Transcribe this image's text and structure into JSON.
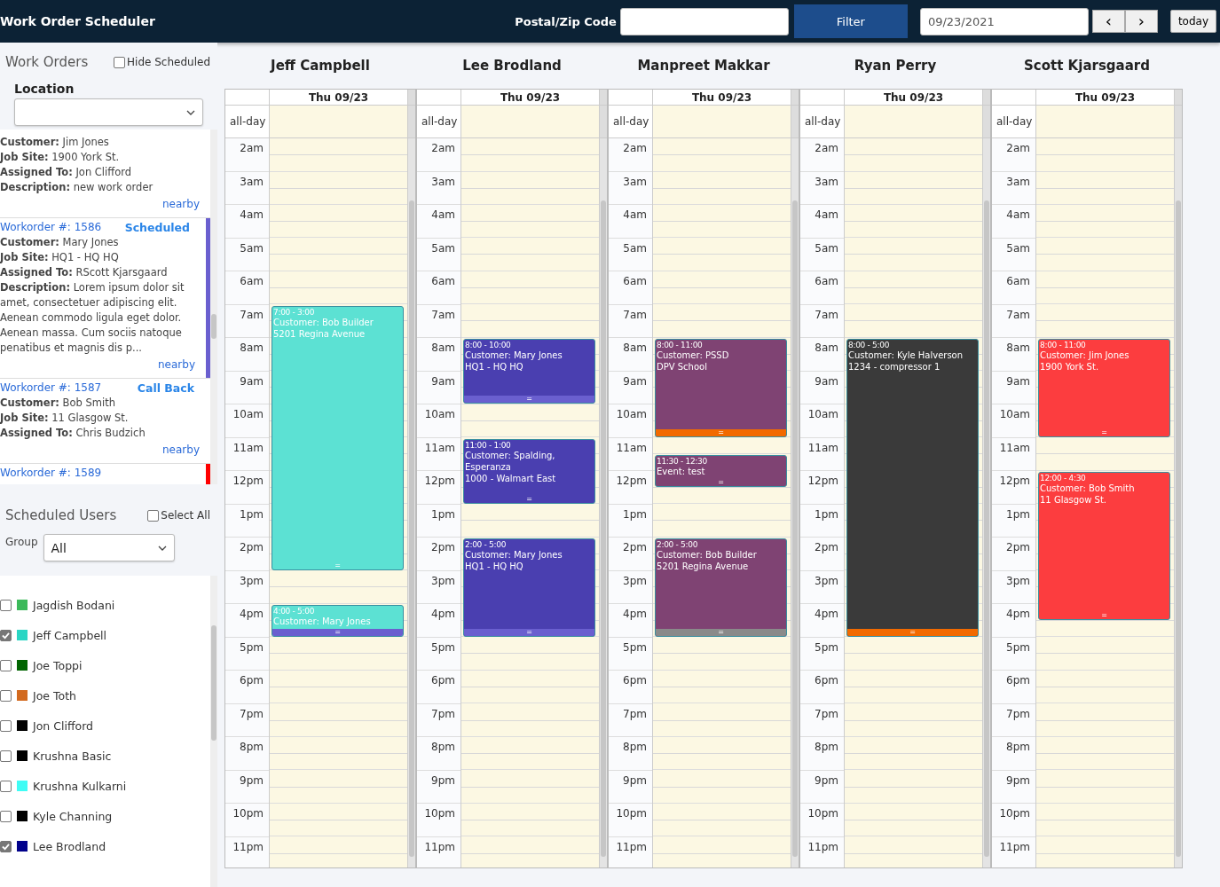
{
  "header": {
    "title": "Work Order Scheduler",
    "postal_label": "Postal/Zip Code",
    "filter_button": "Filter",
    "date_value": "09/23/2021",
    "prev_button": "‹",
    "next_button": "›",
    "today_button": "today"
  },
  "work_orders": {
    "heading": "Work Orders",
    "hide_scheduled": {
      "label": "Hide Scheduled",
      "checked": false
    },
    "location_label": "Location",
    "cards": [
      {
        "lines": [
          "**Customer:** Jim Jones",
          "**Job Site:** 1900 York St.",
          "**Assigned To:** Jon Clifford",
          "**Description:** new work order"
        ],
        "link": "nearby"
      },
      {
        "title": "Workorder #: 1586",
        "status": "Scheduled",
        "color": "#6a5fcf",
        "lines": [
          "**Customer:** Mary Jones",
          "**Job Site:** HQ1 - HQ HQ",
          "**Assigned To:** RScott Kjarsgaard",
          "**Description:** Lorem ipsum dolor sit amet, consectetuer adipiscing elit. Aenean commodo ligula eget dolor. Aenean massa. Cum sociis natoque penatibus et magnis dis p..."
        ],
        "link": "nearby"
      },
      {
        "title": "Workorder #: 1587",
        "status": "Call Back",
        "lines": [
          "**Customer:** Bob Smith",
          "**Job Site:** 11 Glasgow St.",
          "**Assigned To:** Chris Budzich"
        ],
        "link": "nearby"
      },
      {
        "title": "Workorder #: 1589",
        "color": "#ff0000"
      }
    ]
  },
  "scheduled_users": {
    "heading": "Scheduled Users",
    "select_all": {
      "label": "Select All",
      "checked": false
    },
    "group_label": "Group",
    "group_value": "All",
    "users": [
      {
        "name": "Jagdish Bodani",
        "color": "#3cb95a",
        "checked": false
      },
      {
        "name": "Jeff Campbell",
        "color": "#2ad6c4",
        "checked": true
      },
      {
        "name": "Joe Toppi",
        "color": "#006400",
        "checked": false
      },
      {
        "name": "Joe Toth",
        "color": "#d2691e",
        "checked": false
      },
      {
        "name": "Jon Clifford",
        "color": "#000000",
        "checked": false
      },
      {
        "name": "Krushna Basic",
        "color": "#000000",
        "checked": false
      },
      {
        "name": "Krushna Kulkarni",
        "color": "#3ffcf5",
        "checked": false
      },
      {
        "name": "Kyle Channing",
        "color": "#000000",
        "checked": false
      },
      {
        "name": "Lee Brodland",
        "color": "#00008b",
        "checked": true
      }
    ]
  },
  "columns": [
    {
      "name": "Jeff Campbell",
      "date": "Thu 09/23",
      "all_day": "all-day",
      "hours": [
        "2am",
        "3am",
        "4am",
        "5am",
        "6am",
        "7am",
        "8am",
        "9am",
        "10am",
        "11am",
        "12pm",
        "1pm",
        "2pm",
        "3pm",
        "4pm",
        "5pm",
        "6pm",
        "7pm",
        "8pm",
        "9pm",
        "10pm",
        "11pm"
      ],
      "events": [
        {
          "time": "7:00 - 3:00",
          "lines": [
            "Customer: Bob Builder",
            "5201 Regina Avenue"
          ],
          "handle": "=",
          "color": "#5ce1d3"
        },
        {
          "time": "4:00 - 5:00",
          "lines": [
            "Customer: Mary Jones"
          ],
          "handle": "=",
          "color": "#5ce1d3",
          "handle_bar": {
            "color": "#6a5fcf"
          }
        }
      ]
    },
    {
      "name": "Lee Brodland",
      "date": "Thu 09/23",
      "all_day": "all-day",
      "hours": [
        "2am",
        "3am",
        "4am",
        "5am",
        "6am",
        "7am",
        "8am",
        "9am",
        "10am",
        "11am",
        "12pm",
        "1pm",
        "2pm",
        "3pm",
        "4pm",
        "5pm",
        "6pm",
        "7pm",
        "8pm",
        "9pm",
        "10pm",
        "11pm"
      ],
      "events": [
        {
          "time": "8:00 - 10:00",
          "lines": [
            "Customer: Mary Jones",
            "HQ1 - HQ HQ"
          ],
          "handle": "=",
          "color": "#4a3fb0",
          "handle_bar": {
            "color": "#6a5fcf"
          }
        },
        {
          "time": "11:00 - 1:00",
          "lines": [
            "Customer: Spalding, Esperanza",
            "1000 - Walmart East"
          ],
          "handle": "=",
          "color": "#4a3fb0"
        },
        {
          "time": "2:00 - 5:00",
          "lines": [
            "Customer: Mary Jones",
            "HQ1 - HQ HQ"
          ],
          "handle": "=",
          "color": "#4a3fb0",
          "handle_bar": {
            "color": "#6a5fcf"
          }
        }
      ]
    },
    {
      "name": "Manpreet Makkar",
      "date": "Thu 09/23",
      "all_day": "all-day",
      "hours": [
        "2am",
        "3am",
        "4am",
        "5am",
        "6am",
        "7am",
        "8am",
        "9am",
        "10am",
        "11am",
        "12pm",
        "1pm",
        "2pm",
        "3pm",
        "4pm",
        "5pm",
        "6pm",
        "7pm",
        "8pm",
        "9pm",
        "10pm",
        "11pm"
      ],
      "events": [
        {
          "time": "8:00 - 11:00",
          "lines": [
            "Customer: PSSD",
            "DPV School"
          ],
          "handle": "=",
          "color": "#7f4373",
          "handle_bar": {
            "color": "#f26a00"
          }
        },
        {
          "time": "11:30 - 12:30",
          "lines": [
            "Event: test"
          ],
          "handle": "=",
          "color": "#7f4373"
        },
        {
          "time": "2:00 - 5:00",
          "lines": [
            "Customer: Bob Builder",
            "5201 Regina Avenue"
          ],
          "handle": "=",
          "color": "#7f4373",
          "handle_bar": {
            "color": "#8a8a8a"
          }
        }
      ]
    },
    {
      "name": "Ryan Perry",
      "date": "Thu 09/23",
      "all_day": "all-day",
      "hours": [
        "2am",
        "3am",
        "4am",
        "5am",
        "6am",
        "7am",
        "8am",
        "9am",
        "10am",
        "11am",
        "12pm",
        "1pm",
        "2pm",
        "3pm",
        "4pm",
        "5pm",
        "6pm",
        "7pm",
        "8pm",
        "9pm",
        "10pm",
        "11pm"
      ],
      "events": [
        {
          "time": "8:00 - 5:00",
          "lines": [
            "Customer: Kyle Halverson",
            "1234 - compressor 1"
          ],
          "handle": "=",
          "color": "#3a3a3a",
          "handle_bar": {
            "color": "#f26a00"
          }
        }
      ]
    },
    {
      "name": "Scott Kjarsgaard",
      "date": "Thu 09/23",
      "all_day": "all-day",
      "hours": [
        "2am",
        "3am",
        "4am",
        "5am",
        "6am",
        "7am",
        "8am",
        "9am",
        "10am",
        "11am",
        "12pm",
        "1pm",
        "2pm",
        "3pm",
        "4pm",
        "5pm",
        "6pm",
        "7pm",
        "8pm",
        "9pm",
        "10pm",
        "11pm"
      ],
      "events": [
        {
          "time": "8:00 - 11:00",
          "lines": [
            "Customer: Jim Jones",
            "1900 York St."
          ],
          "handle": "=",
          "color": "#fc3d3f"
        },
        {
          "time": "12:00 - 4:30",
          "lines": [
            "Customer: Bob Smith",
            "11 Glasgow St."
          ],
          "handle": "=",
          "color": "#fc3d3f"
        }
      ]
    }
  ]
}
